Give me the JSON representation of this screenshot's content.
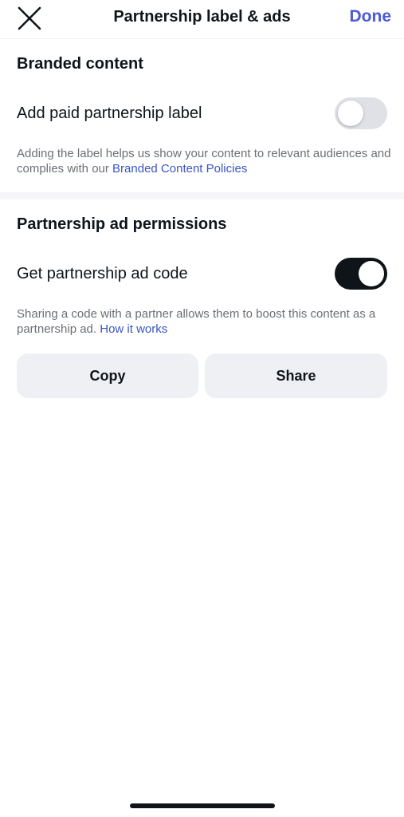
{
  "header": {
    "title": "Partnership label & ads",
    "done_label": "Done"
  },
  "branded_content": {
    "section_title": "Branded content",
    "toggle_label": "Add paid partnership label",
    "toggle_on": false,
    "description": "Adding the label helps us show your content to relevant audiences and complies with our ",
    "link_text": "Branded Content Policies"
  },
  "partnership_ads": {
    "section_title": "Partnership ad permissions",
    "toggle_label": "Get partnership ad code",
    "toggle_on": true,
    "description": "Sharing a code with a partner allows them to boost this content as a partnership ad. ",
    "link_text": "How it works",
    "copy_label": "Copy",
    "share_label": "Share"
  },
  "icons": {
    "close": "close-icon"
  },
  "colors": {
    "accent": "#4a5bd4",
    "link": "#3a55c4",
    "toggle_on": "#0f1419",
    "toggle_off": "#dfe1e6"
  }
}
